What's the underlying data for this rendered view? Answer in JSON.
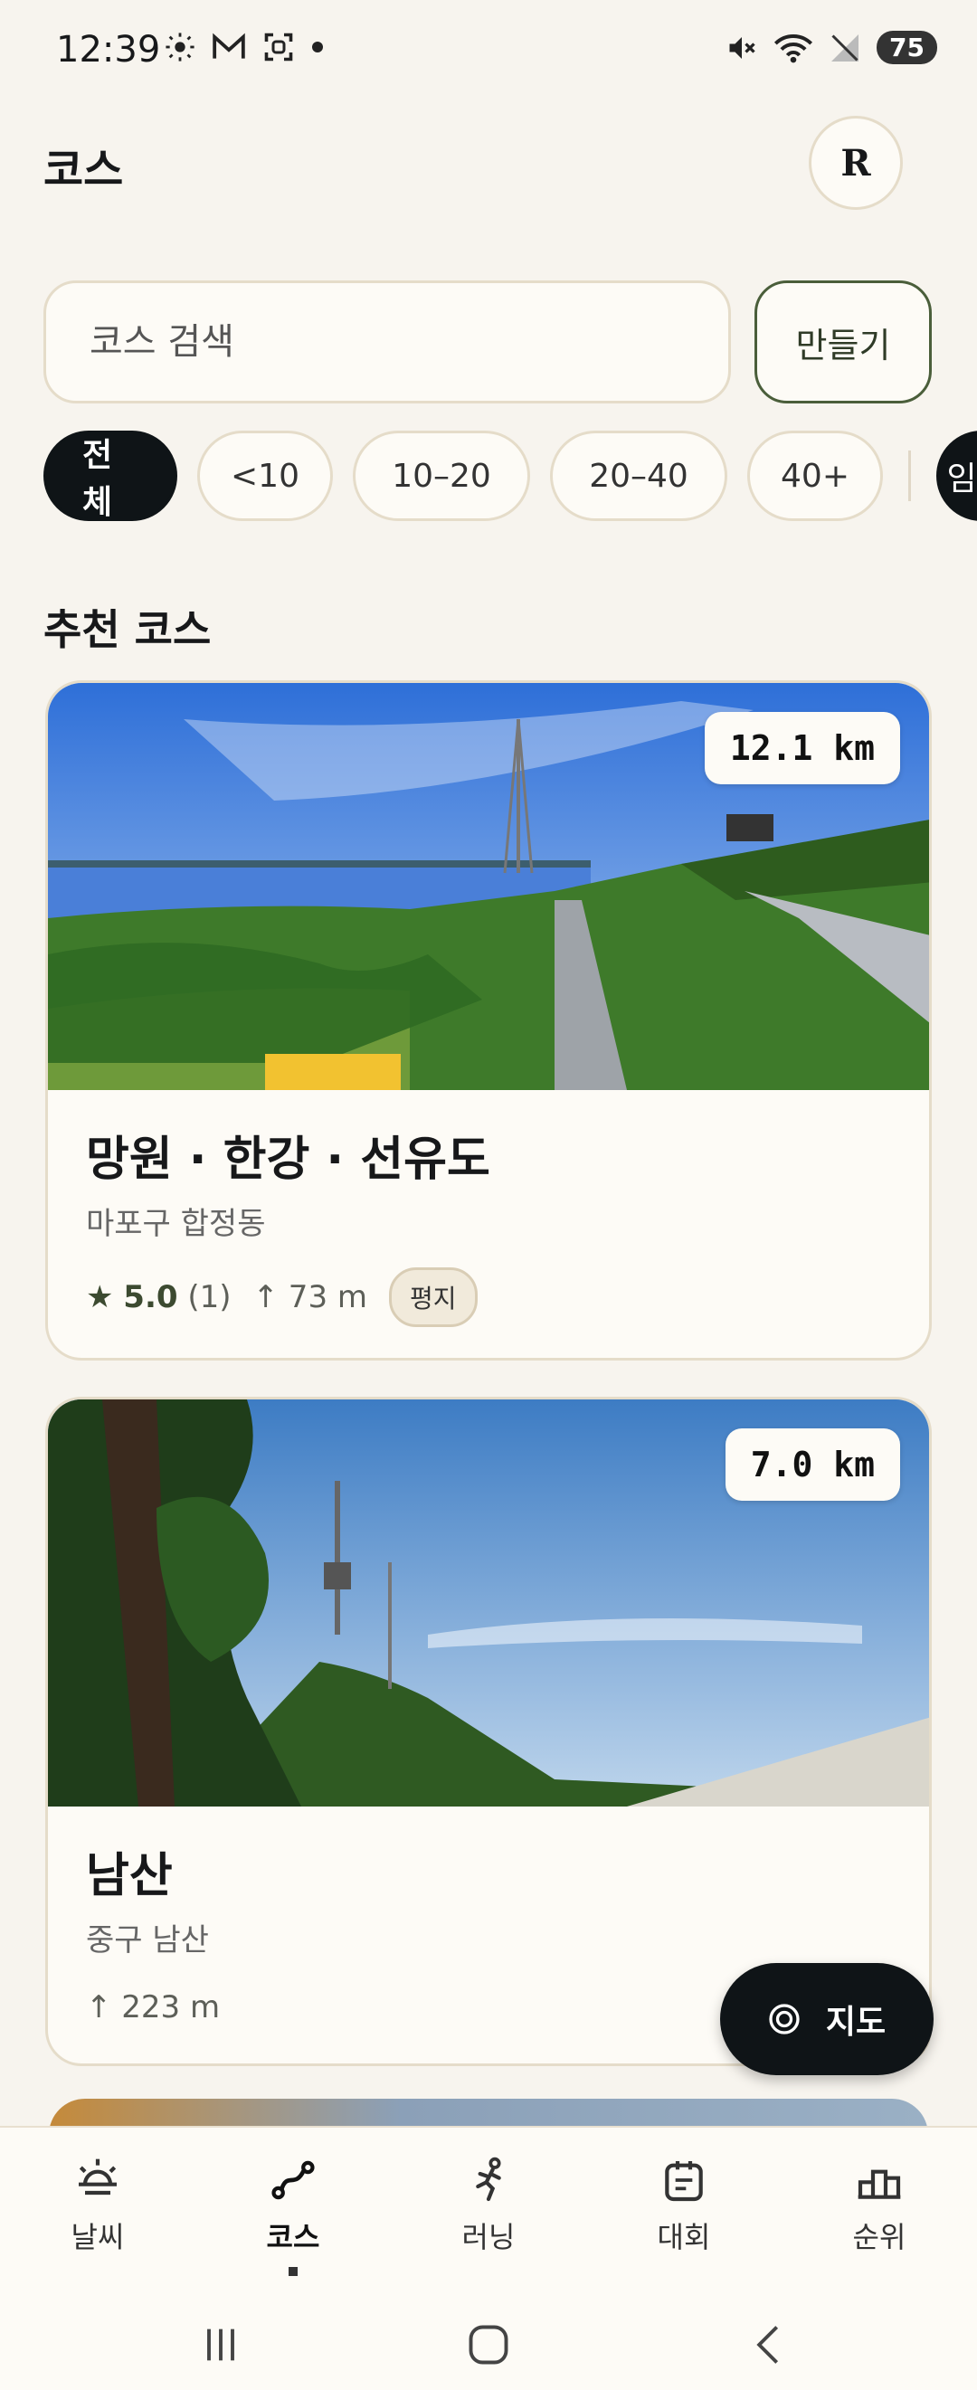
{
  "status_bar": {
    "time": "12:39",
    "battery": "75"
  },
  "header": {
    "title": "코스",
    "avatar_letter": "R"
  },
  "search": {
    "placeholder": "코스 검색",
    "create_label": "만들기"
  },
  "filters": [
    {
      "label": "전체",
      "active": true
    },
    {
      "label": "<10",
      "active": false
    },
    {
      "label": "10–20",
      "active": false
    },
    {
      "label": "20–40",
      "active": false
    },
    {
      "label": "40+",
      "active": false
    }
  ],
  "filter_partial_label": "임",
  "section_title": "추천 코스",
  "courses": [
    {
      "distance": "12.1 km",
      "name": "망원 · 한강 · 선유도",
      "location": "마포구 합정동",
      "rating": "5.0",
      "rating_count": "(1)",
      "elevation": "↑ 73 m",
      "terrain": "평지"
    },
    {
      "distance": "7.0 km",
      "name": "남산",
      "location": "중구 남산",
      "elevation": "↑ 223 m"
    }
  ],
  "fab": {
    "label": "지도",
    "icon": "target-icon"
  },
  "bottom_nav": [
    {
      "label": "날씨",
      "icon": "sun-icon",
      "active": false
    },
    {
      "label": "코스",
      "icon": "route-icon",
      "active": true
    },
    {
      "label": "러닝",
      "icon": "runner-icon",
      "active": false
    },
    {
      "label": "대회",
      "icon": "calendar-icon",
      "active": false
    },
    {
      "label": "순위",
      "icon": "podium-icon",
      "active": false
    }
  ],
  "colors": {
    "background": "#F7F4EE",
    "accent_dark": "#0F1417",
    "olive": "#3C4A30",
    "border": "#E5DCC9"
  }
}
